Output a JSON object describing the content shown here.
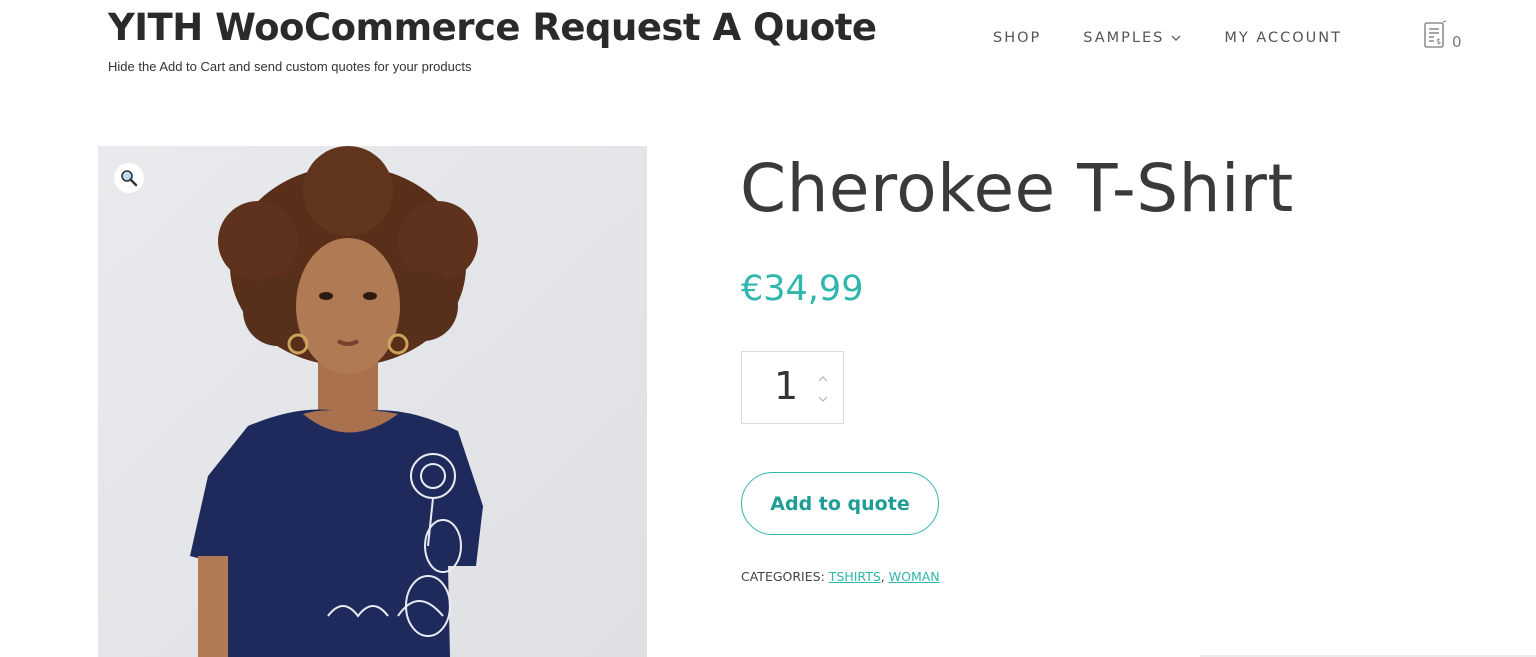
{
  "header": {
    "site_title": "YITH WooCommerce Request A Quote",
    "tagline": "Hide the Add to Cart and send custom quotes for your products",
    "nav": {
      "shop": "SHOP",
      "samples": "SAMPLES",
      "my_account": "MY ACCOUNT"
    },
    "cart_count": "0"
  },
  "product": {
    "title": "Cherokee T-Shirt",
    "price": "€34,99",
    "quantity": "1",
    "add_to_quote_label": "Add to quote",
    "categories_label": "CATEGORIES:",
    "categories": [
      "TSHIRTS",
      "WOMAN"
    ],
    "category_separator": ","
  },
  "colors": {
    "accent": "#2fb6ad",
    "shirt": "#1f2a5c",
    "hair": "#5a2f1a",
    "skin": "#b07a55",
    "image_bg": "#e6e7ea"
  },
  "icons": {
    "zoom": "magnifier-icon",
    "cart": "quote-list-icon",
    "samples_dropdown": "chevron-down-icon"
  }
}
